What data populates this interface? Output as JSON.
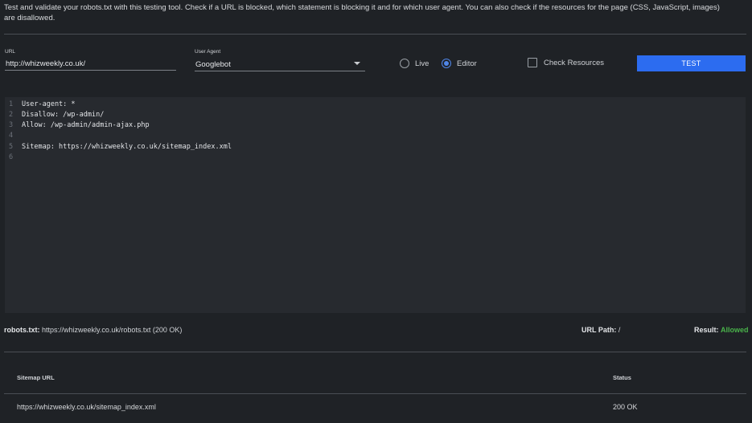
{
  "intro_text": "Test and validate your robots.txt with this testing tool. Check if a URL is blocked, which statement is blocking it and for which user agent. You can also check if the resources for the page (CSS, JavaScript, images) are disallowed.",
  "url_field": {
    "label": "URL",
    "value": "http://whizweekly.co.uk/"
  },
  "user_agent": {
    "label": "User Agent",
    "selected": "Googlebot"
  },
  "mode": {
    "live_label": "Live",
    "editor_label": "Editor",
    "selected": "Editor"
  },
  "check_resources": {
    "label": "Check Resources",
    "checked": false
  },
  "test_button": {
    "label": "TEST"
  },
  "editor": {
    "lines": [
      {
        "num": "1",
        "text": "User-agent: *"
      },
      {
        "num": "2",
        "text": "Disallow: /wp-admin/"
      },
      {
        "num": "3",
        "text": "Allow: /wp-admin/admin-ajax.php"
      },
      {
        "num": "4",
        "text": ""
      },
      {
        "num": "5",
        "text": "Sitemap: https://whizweekly.co.uk/sitemap_index.xml"
      },
      {
        "num": "6",
        "text": ""
      }
    ]
  },
  "status_bar": {
    "robots_label": "robots.txt:",
    "robots_value": "https://whizweekly.co.uk/robots.txt (200 OK)",
    "url_path_label": "URL Path:",
    "url_path_value": "/",
    "result_label": "Result:",
    "result_value": "Allowed"
  },
  "sitemap_table": {
    "headers": [
      "Sitemap URL",
      "Status"
    ],
    "rows": [
      [
        "https://whizweekly.co.uk/sitemap_index.xml",
        "200 OK"
      ]
    ]
  },
  "colors": {
    "background": "#1f2226",
    "editor_background": "#272a2f",
    "accent": "#2c6cf0",
    "allowed": "#49b24a"
  }
}
